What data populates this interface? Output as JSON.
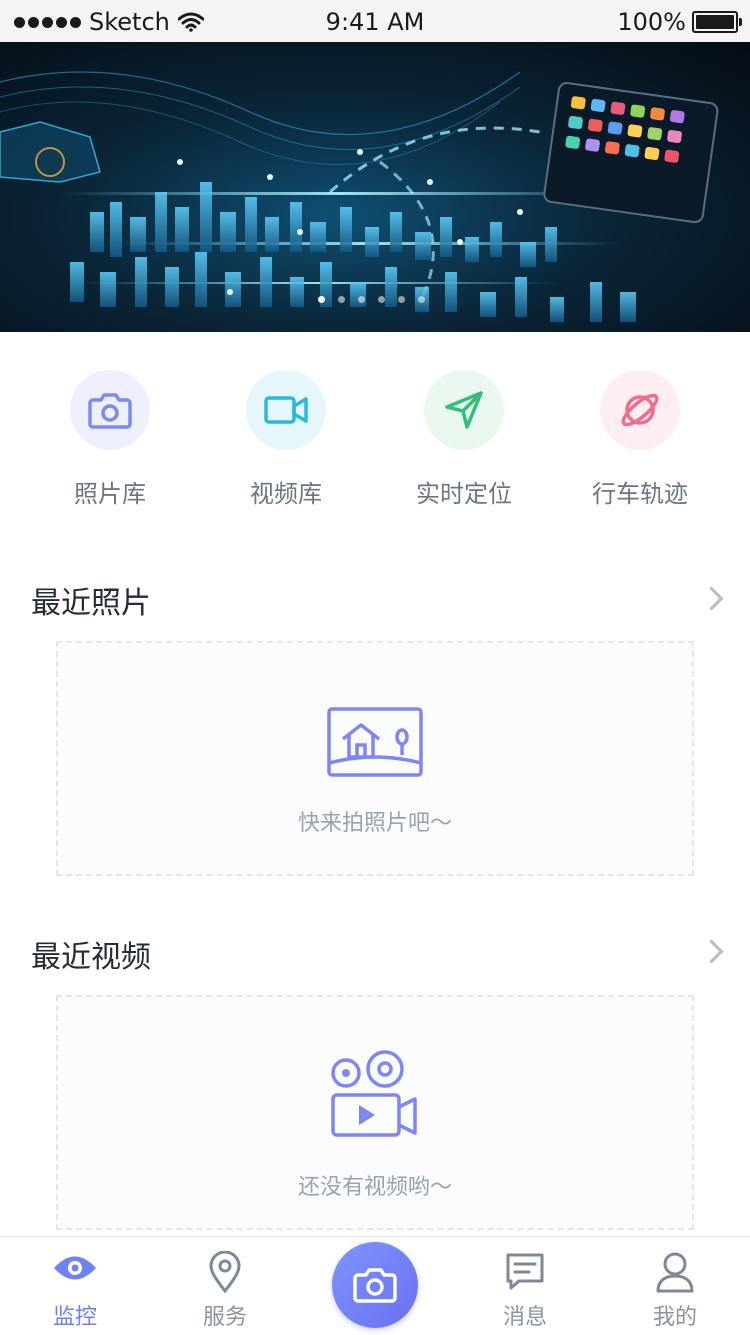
{
  "status_bar": {
    "carrier": "Sketch",
    "time": "9:41 AM",
    "battery": "100%"
  },
  "banner": {
    "slide_count": 6,
    "active_index": 0
  },
  "quick_actions": [
    {
      "label": "照片库",
      "icon": "camera-icon",
      "color": "#7b8bf3",
      "bg": "#eef0fd"
    },
    {
      "label": "视频库",
      "icon": "video-camera-icon",
      "color": "#2cb8d9",
      "bg": "#e6f7fb"
    },
    {
      "label": "实时定位",
      "icon": "navigation-arrow-icon",
      "color": "#2fc07a",
      "bg": "#eaf8ef"
    },
    {
      "label": "行车轨迹",
      "icon": "planet-icon",
      "color": "#f26b8e",
      "bg": "#fdeef2"
    }
  ],
  "recent_photos": {
    "title": "最近照片",
    "empty_text": "快来拍照片吧～"
  },
  "recent_videos": {
    "title": "最近视频",
    "empty_text": "还没有视频哟～"
  },
  "tab_bar": {
    "tabs": [
      {
        "label": "监控",
        "icon": "eye-icon",
        "active": true
      },
      {
        "label": "服务",
        "icon": "location-pin-icon",
        "active": false
      },
      {
        "label": "消息",
        "icon": "message-icon",
        "active": false
      },
      {
        "label": "我的",
        "icon": "user-icon",
        "active": false
      }
    ],
    "center_button_icon": "camera-icon"
  },
  "colors": {
    "accent": "#6f82f5",
    "tab_inactive": "#8a93a0"
  }
}
